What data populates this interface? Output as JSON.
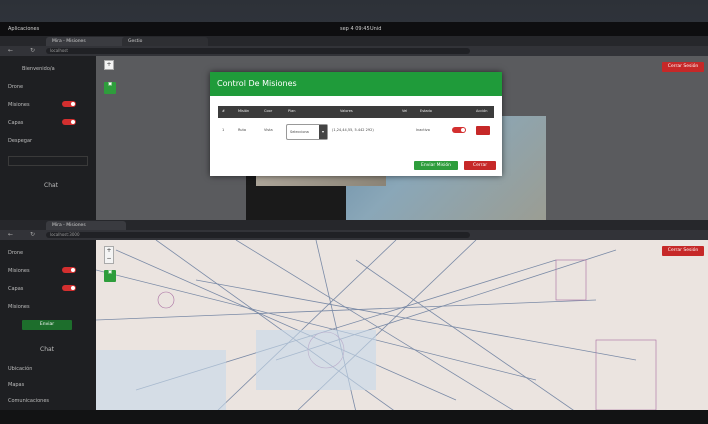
{
  "top_screen": {
    "system_bar": {
      "left": "Aplicaciones",
      "center": "sep 4 09:45",
      "status": "Unid"
    },
    "tabs": [
      {
        "label": "Mira - Misiones"
      },
      {
        "label": "Gestio"
      }
    ],
    "url": "localhost",
    "logout_label": "Cerrar Sesión",
    "sidebar": {
      "heading": "Bienvenido/a",
      "items": [
        {
          "label": "Drone"
        },
        {
          "label": "Misiones"
        },
        {
          "label": "Capas"
        },
        {
          "label": "Despegar"
        }
      ],
      "chat_label": "Chat"
    },
    "modal": {
      "title": "Control De Misiones",
      "columns": [
        "#",
        "Misión",
        "Coor",
        "Plan",
        "Valores",
        "Vel",
        "Estado",
        "Acción"
      ],
      "row": {
        "index": "1",
        "mission": "Ruta",
        "coor": "Vista",
        "plan_value": "Selecciona",
        "values": "(1,24,44,55, 5.442 292)",
        "status": "Inactivo"
      },
      "primary_button": "Enviar Misión",
      "secondary_button": "Cerrar"
    }
  },
  "bottom_screen": {
    "tabs": [
      {
        "label": "Mira - Misiones"
      }
    ],
    "url": "localhost:3000",
    "logout_label": "Cerrar Sesión",
    "sidebar": {
      "items": [
        {
          "label": "Drone"
        },
        {
          "label": "Misiones"
        },
        {
          "label": "Capas"
        },
        {
          "label": "Misiones"
        }
      ],
      "button_label": "Enviar",
      "chat_label": "Chat",
      "bottom_items": [
        {
          "label": "Ubicación"
        },
        {
          "label": "Mapas"
        },
        {
          "label": "Comunicaciones"
        }
      ]
    }
  },
  "colors": {
    "green": "#1f9b3a",
    "red": "#c62828",
    "sidebar": "#1e1f22"
  }
}
